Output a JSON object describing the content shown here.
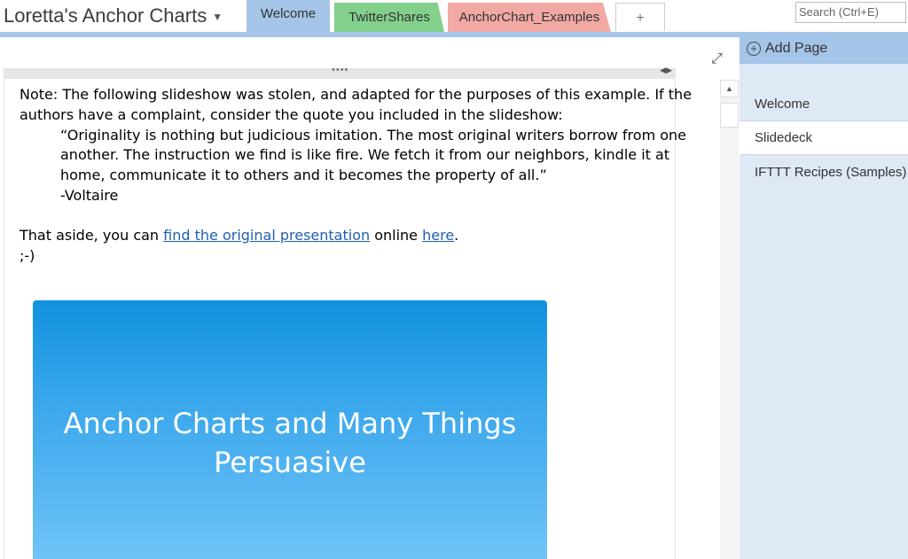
{
  "notebook": {
    "title": "Loretta's Anchor Charts"
  },
  "tabs": [
    {
      "label": "Welcome",
      "color": "#a4c5e8"
    },
    {
      "label": "TwitterShares",
      "color": "#82d08c"
    },
    {
      "label": "AnchorChart_Examples",
      "color": "#f2a9a4"
    },
    {
      "label": "+"
    }
  ],
  "search": {
    "placeholder": "Search (Ctrl+E)"
  },
  "note": {
    "line1": "Note: The following slideshow was stolen, and adapted for the purposes of this example. If the",
    "line2": "authors have a complaint, consider the quote you included in the slideshow:",
    "quote1": "“Originality is nothing but judicious imitation.  The most original writers borrow from one",
    "quote2": "another.  The instruction we find is like fire.  We fetch it from our neighbors, kindle it at",
    "quote3": "home, communicate it to others and it becomes the property of all.”",
    "attribution": "-Voltaire",
    "aside_prefix": "That aside, you can ",
    "link1": "find the original presentation",
    "aside_middle": " online ",
    "link2": "here",
    "aside_suffix": ".",
    "wink": ";-)"
  },
  "slide": {
    "title_line1": "Anchor Charts and Many Things",
    "title_line2": "Persuasive"
  },
  "pagelist": {
    "add_label": "Add Page",
    "items": [
      "Welcome",
      "Slidedeck",
      "IFTTT Recipes (Samples)"
    ],
    "selected": "Slidedeck"
  }
}
